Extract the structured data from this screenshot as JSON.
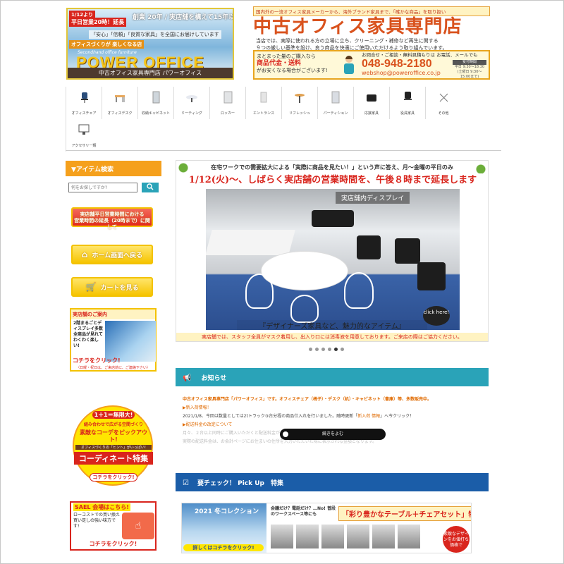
{
  "header": {
    "logo": {
      "tag_small": "1/12より",
      "tag_main": "平日営業20時！延長",
      "catch1": "創業 20年 / 実店舗を構えて15年以上",
      "catch2": "「安心」「信頼」「良質な家具」を全国にお届けしています",
      "catch3": "オフィスづくりが 楽しくなる店",
      "sub": "Secondhand office furniture",
      "brand": "POWER OFFICE",
      "bottom": "中古オフィス家具専門店 パワーオフィス"
    },
    "notice": "国内外の一流オフィス家具メーカーから、海外ブランド家具まで、「確かな商品」を取り扱い",
    "store_title": "中古オフィス家具専門店",
    "desc_line1": "当店では、実際に使われる方の立場に立ち、クリーニング・補修など再生に関する",
    "desc_line2": "９つの厳しい基準を設け、良う商品を快適にご使用いただけるよう取り組んでいます。",
    "contact": {
      "left_line1": "まとまった量のご購入なら",
      "left_line2": "商品代金・送料",
      "left_line3": "がお安くなる場合がございます!",
      "mid_line1": "お問合せ・ご相談・無料見積もりは お電話、メールでも",
      "tel": "048-948-2180",
      "mail": "webshop@poweroffice.co.jp",
      "hours_label": "受付時間",
      "hours1": "平日 9:30〜18:30",
      "hours2": "(土曜日 9:30〜15:00まで)"
    }
  },
  "categories": [
    {
      "label": "オフィスチェア",
      "icon": "office-chair-icon"
    },
    {
      "label": "オフィスデスク",
      "icon": "office-desk-icon"
    },
    {
      "label": "収納キャビネット",
      "icon": "cabinet-icon"
    },
    {
      "label": "ミーティング",
      "icon": "meeting-table-icon"
    },
    {
      "label": "ロッカー",
      "icon": "locker-icon"
    },
    {
      "label": "エントランス",
      "icon": "entrance-icon"
    },
    {
      "label": "リフレッシュ",
      "icon": "refresh-table-icon"
    },
    {
      "label": "パーティション",
      "icon": "partition-icon"
    },
    {
      "label": "応接家具",
      "icon": "reception-sofa-icon"
    },
    {
      "label": "役員家具",
      "icon": "executive-chair-icon"
    },
    {
      "label": "その他",
      "icon": "other-icon"
    },
    {
      "label": "アクセサリー類",
      "icon": "monitor-icon"
    }
  ],
  "sidebar": {
    "search_title": "▼アイテム検索",
    "search_placeholder": "何をお探しですか?",
    "search_btn_icon": "search-icon",
    "hours_btn_line1": "実店舗平日営業時間における",
    "hours_btn_line2": "営業時間の延長（20時まで）に関して",
    "home_btn": "ホーム画面へ戻る",
    "cart_btn": "カートを見る",
    "shop_banner": {
      "title": "実店舗のご案内",
      "text": "2階まるごとディスプレイ多数全商品が見れて わくわく楽しい!",
      "click": "コチラをクリック!",
      "note": "〈日曜・祝日は、ご来店前に、ご連絡下さい〉"
    },
    "coord_banner": {
      "l1": "1＋1＝無限大!",
      "l2": "組み合わせで広がる空間づくり",
      "l3": "素敵なコーデをピックアウト!",
      "l4": "オフィスづくりの「ヒント」がいっぱい!",
      "l5": "コーディネート特集",
      "l6": "コチラをクリック!"
    },
    "sael_banner": {
      "title": "SAEL 会場はこちら!",
      "text": "ローコストでの買い換え買い足しの強い味方です!",
      "click": "コチラをクリック!"
    }
  },
  "slider": {
    "headline": "在宅ワークでの需要拡大による「実際に商品を見たい！」という声に答え、月～金曜の平日のみ",
    "banner": "1/12(火)～、しばらく実店舗の営業時間を、午後８時まで延長します",
    "label": "実店舗内ディスプレイ",
    "caption": "『デザイナーズ家具など、魅力的なアイテム』",
    "click": "click here!",
    "foot": "実店舗では、スタッフ全員がマスク着用し、出入り口には消毒液を用意しております。ご来店の際はご協力ください。",
    "active_slide": 5,
    "slide_count": 6
  },
  "news": {
    "heading": "お知らせ",
    "lead": "中古オフィス家具専門店「パワーオフィス」です。オフィスチェア（椅子）・デスク（机）・キャビネット（書庫）等、多数販売中。",
    "cat1": "▶新入荷情報！",
    "item1_pre": "2021/1/8、今回は数量としては2tトラック③台分程の商品仕入れを行いました。随時更新「",
    "item1_link": "新入荷 情報",
    "item1_post": "」へ今クリック！",
    "cat2": "▶配送料金の改定について",
    "faded1": "月々、２台以上同時にご購入いただくと配送料金がお得になる場合がございます。",
    "faded2": "実際の配送料金は、お会計ページにお住まいの住所を入力いただいた際に表示される金額となります。",
    "readmore": "続きをよむ"
  },
  "pickup": {
    "heading": "要チェック！ Pick Up　特集",
    "winter": "2021 冬コレクション",
    "winter_cta": "詳しくはコチラをクリック!",
    "question": "会議だけ？電話だけ？…No! 普段のワークスペース等にも",
    "title": "「彩り豊かなテーブル＋チェアセット」特集",
    "badge": "素敵なデザインをお値打ち価格で"
  },
  "colors": {
    "accent_orange": "#f5a01c",
    "teal": "#2aa3b8",
    "navy": "#1b5da8",
    "red": "#d9251d"
  }
}
